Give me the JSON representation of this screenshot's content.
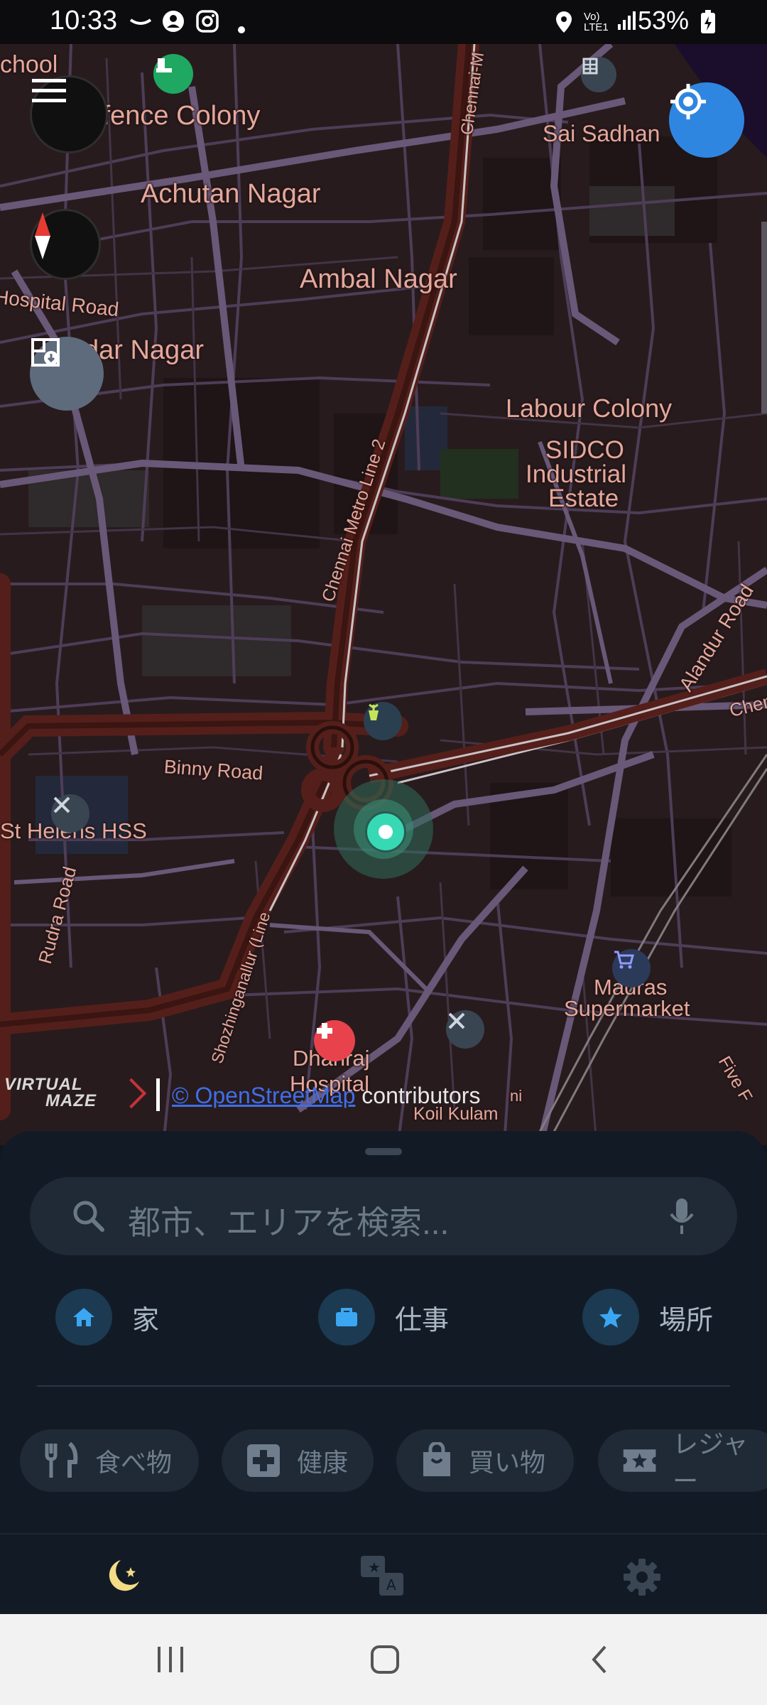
{
  "status_bar": {
    "time": "10:33",
    "battery": "53%",
    "icons": [
      "missed-call-icon",
      "account-icon",
      "instagram-icon",
      "dot-icon",
      "location-icon",
      "volte-lte-icon",
      "signal-icon",
      "battery-icon"
    ]
  },
  "map": {
    "labels": {
      "school": "chool",
      "defence_colony": "Defence Colony",
      "sai_sadhan": "Sai Sadhan",
      "achutan_nagar": "Achutan Nagar",
      "ambal_nagar": "Ambal Nagar",
      "hospital_road": "Hospital Road",
      "dar_nagar": "dar Nagar",
      "labour_colony": "Labour Colony",
      "sidco_1": "SIDCO",
      "sidco_2": "Industrial",
      "sidco_3": "Estate",
      "chennai_metro_line2": "Chennai Metro Line 2",
      "chennai_top": "Chennai-M",
      "alandur_road": "Alandur Road",
      "chen_right": "Chen",
      "binny_road": "Binny Road",
      "st_helens": "St Helens HSS",
      "rudra_road": "Rudra Road",
      "sholinganallur": "Shozhinganallur (Line",
      "madras_1": "Madras",
      "madras_2": "Supermarket",
      "five": "Five F",
      "dhanraj_1": "Dhanraj",
      "dhanraj_2": "Hospital",
      "koil_kulam": "Koil Kulam",
      "kulam_top": "ni"
    },
    "attribution": {
      "brand_top": "VIRTUAL",
      "brand_bottom": "MAZE",
      "link": "© OpenStreetMap",
      "text": "contributors"
    }
  },
  "search": {
    "placeholder": "都市、エリアを検索..."
  },
  "quick_places": [
    {
      "label": "家",
      "icon": "home-icon"
    },
    {
      "label": "仕事",
      "icon": "briefcase-icon"
    },
    {
      "label": "場所",
      "icon": "star-icon"
    }
  ],
  "categories": [
    {
      "label": "食べ物",
      "icon": "fork-knife-icon"
    },
    {
      "label": "健康",
      "icon": "medical-cross-icon"
    },
    {
      "label": "買い物",
      "icon": "shopping-bag-icon"
    },
    {
      "label": "レジャー",
      "icon": "ticket-star-icon"
    }
  ],
  "tabs": [
    {
      "name": "night-mode-tab",
      "icon": "moon-star-icon"
    },
    {
      "name": "translate-tab",
      "icon": "translate-icon"
    },
    {
      "name": "settings-tab",
      "icon": "gear-icon"
    }
  ],
  "colors": {
    "accent": "#2f86e0",
    "quick_icon": "#3ba7f2",
    "map_label": "#e6a79a",
    "road": "#5a4868",
    "major_road": "#4a1c17",
    "location_dot": "#37d9b5"
  }
}
